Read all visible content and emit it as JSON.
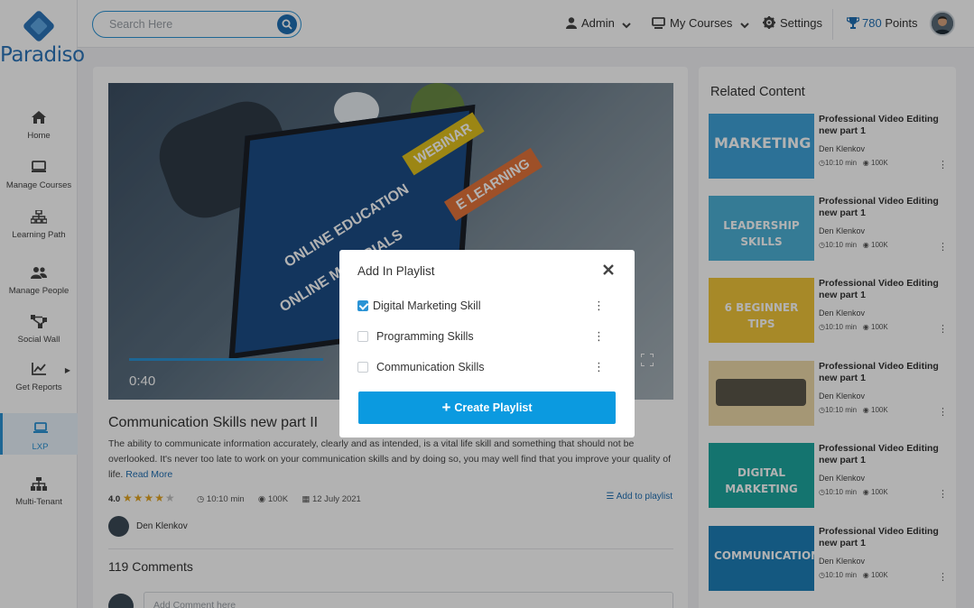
{
  "brand": {
    "name": "Paradiso"
  },
  "search": {
    "placeholder": "Search Here"
  },
  "header": {
    "admin": "Admin",
    "my_courses": "My Courses",
    "settings": "Settings",
    "points": "780",
    "points_label": "Points"
  },
  "sidebar": {
    "items": [
      {
        "label": "Home",
        "icon": "home-icon"
      },
      {
        "label": "Manage Courses",
        "icon": "monitor-icon"
      },
      {
        "label": "Learning Path",
        "icon": "sitemap-icon"
      },
      {
        "label": "Manage People",
        "icon": "users-icon"
      },
      {
        "label": "Social Wall",
        "icon": "network-icon"
      },
      {
        "label": "Get Reports",
        "icon": "chart-icon"
      },
      {
        "label": "LXP",
        "icon": "laptop-icon"
      },
      {
        "label": "Multi-Tenant",
        "icon": "hierarchy-icon"
      }
    ]
  },
  "video": {
    "time": "0:40",
    "progress": 0.37,
    "title": "Communication Skills new part II",
    "description": "The ability to communicate information accurately, clearly and as intended, is a vital life skill and something that should not be overlooked. It's never too late to work on your communication skills and by doing so, you may well find that you improve your quality of life.",
    "read_more": "Read More",
    "rating": "4.0",
    "stars_filled": 4,
    "stars_total": 5,
    "duration": "10:10 min",
    "views": "100K",
    "date": "12 July 2021",
    "add_to_playlist": "Add to playlist",
    "author": "Den Klenkov",
    "overlay_words": [
      "ONLINE EDUCATION",
      "ONLINE MATERIALS",
      "WEBINAR",
      "E LEARNING"
    ]
  },
  "comments": {
    "title": "119 Comments",
    "placeholder": "Add Comment here"
  },
  "related": {
    "title": "Related Content",
    "items": [
      {
        "title": "Professional Video Editing new part 1",
        "author": "Den Klenkov",
        "duration": "10:10 min",
        "views": "100K",
        "thumb_text": "MARKETING",
        "thumb_color": "#3fa3d8"
      },
      {
        "title": "Professional Video Editing new part 1",
        "author": "Den Klenkov",
        "duration": "10:10 min",
        "views": "100K",
        "thumb_text": "LEADERSHIP SKILLS",
        "thumb_color": "#4db0d6"
      },
      {
        "title": "Professional Video Editing new part 1",
        "author": "Den Klenkov",
        "duration": "10:10 min",
        "views": "100K",
        "thumb_text": "6 BEGINNER TIPS",
        "thumb_color": "#f0c53a"
      },
      {
        "title": "Professional Video Editing new part 1",
        "author": "Den Klenkov",
        "duration": "10:10 min",
        "views": "100K",
        "thumb_text": "",
        "thumb_color": "#ecd9a8"
      },
      {
        "title": "Professional Video Editing new part 1",
        "author": "Den Klenkov",
        "duration": "10:10 min",
        "views": "100K",
        "thumb_text": "DIGITAL MARKETING",
        "thumb_color": "#1ea6a0"
      },
      {
        "title": "Professional Video Editing new part 1",
        "author": "Den Klenkov",
        "duration": "10:10 min",
        "views": "100K",
        "thumb_text": "COMMUNICATION",
        "thumb_color": "#1d7fb8"
      }
    ]
  },
  "modal": {
    "title": "Add In Playlist",
    "playlists": [
      {
        "label": "Digital Marketing Skill",
        "checked": true
      },
      {
        "label": "Programming Skills",
        "checked": false
      },
      {
        "label": "Communication Skills",
        "checked": false
      }
    ],
    "create_label": "Create Playlist"
  },
  "colors": {
    "accent": "#2a93d5",
    "button": "#0b9ae0",
    "brand": "#2c74b9",
    "star": "#e2a523"
  }
}
